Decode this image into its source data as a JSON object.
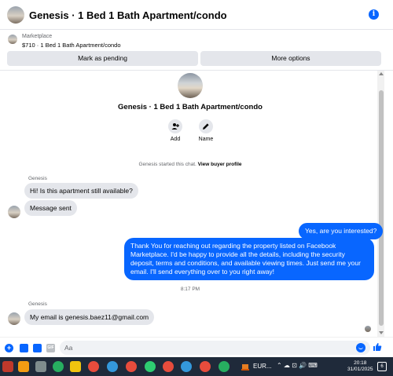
{
  "header": {
    "title": "Genesis · 1 Bed 1 Bath Apartment/condo",
    "info_icon": "info-icon"
  },
  "listing": {
    "label": "Marketplace",
    "price_title": "$710 · 1 Bed 1 Bath Apartment/condo",
    "mark_pending_label": "Mark as pending",
    "more_options_label": "More options"
  },
  "conversation": {
    "title": "Genesis · 1 Bed 1 Bath Apartment/condo",
    "actions": [
      {
        "label": "Add",
        "icon": "add-person-icon"
      },
      {
        "label": "Name",
        "icon": "pencil-icon"
      }
    ],
    "system_note": "Genesis started this chat.",
    "view_profile_label": "View buyer profile",
    "messages": [
      {
        "sender": "Genesis",
        "text": "Hi! Is this apartment still available?"
      },
      {
        "text": "Message sent"
      },
      {
        "text": "Yes, are you interested?"
      },
      {
        "text": "Thank You for reaching out regarding the property listed on Facebook Marketplace. I'd be happy to provide all the details, including the security deposit, terms and conditions, and available viewing times. Just send me your email. I'll send everything over to you right away!"
      },
      {
        "sender": "Genesis",
        "text": "My email is genesis.baez11@gmail.com"
      }
    ],
    "time_divider": "8:17 PM"
  },
  "composer": {
    "placeholder": "Aa"
  },
  "taskbar": {
    "weather_label": "EUR...",
    "time": "20:18",
    "date": "31/01/2025",
    "notifications": "6",
    "app_colors": [
      "#c0392b",
      "#f1c40f",
      "#ffffff",
      "#f1c40f",
      "#e74c3c"
    ]
  }
}
